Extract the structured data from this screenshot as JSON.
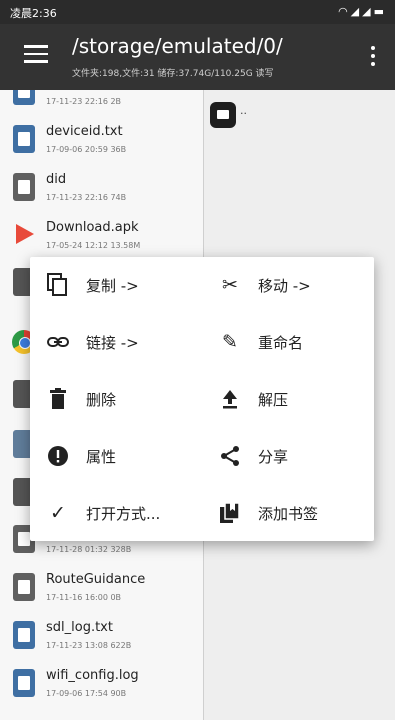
{
  "status": {
    "time": "凌晨2:36",
    "icons": "wifi-icon signal-icon battery-icon"
  },
  "toolbar": {
    "path": "/storage/emulated/0/",
    "info": "文件夹:198,文件:31  储存:37.74G/110.25G  读写"
  },
  "files": [
    {
      "name": "",
      "meta": "17-11-23 22:16  2B",
      "icon": "document-icon"
    },
    {
      "name": "deviceid.txt",
      "meta": "17-09-06 20:59  36B",
      "icon": "document-icon"
    },
    {
      "name": "did",
      "meta": "17-11-23 22:16  74B",
      "icon": "document-icon"
    },
    {
      "name": "Download.apk",
      "meta": "17-05-24 12:12  13.58M",
      "icon": "apk-icon"
    },
    {
      "name": "",
      "meta": "17-11-28 01:32  328B",
      "icon": "document-icon"
    },
    {
      "name": "RouteGuidance",
      "meta": "17-11-16 16:00  0B",
      "icon": "document-icon"
    },
    {
      "name": "sdl_log.txt",
      "meta": "17-11-23 13:08  622B",
      "icon": "document-icon"
    },
    {
      "name": "wifi_config.log",
      "meta": "17-09-06 17:54  90B",
      "icon": "document-icon"
    }
  ],
  "right_pane": {
    "parent_label": "..",
    "watermark": ""
  },
  "context_menu": {
    "copy": "复制 ->",
    "move": "移动 ->",
    "link": "链接 ->",
    "rename": "重命名",
    "delete": "删除",
    "extract": "解压",
    "properties": "属性",
    "share": "分享",
    "open_with": "打开方式...",
    "bookmark": "添加书签"
  }
}
